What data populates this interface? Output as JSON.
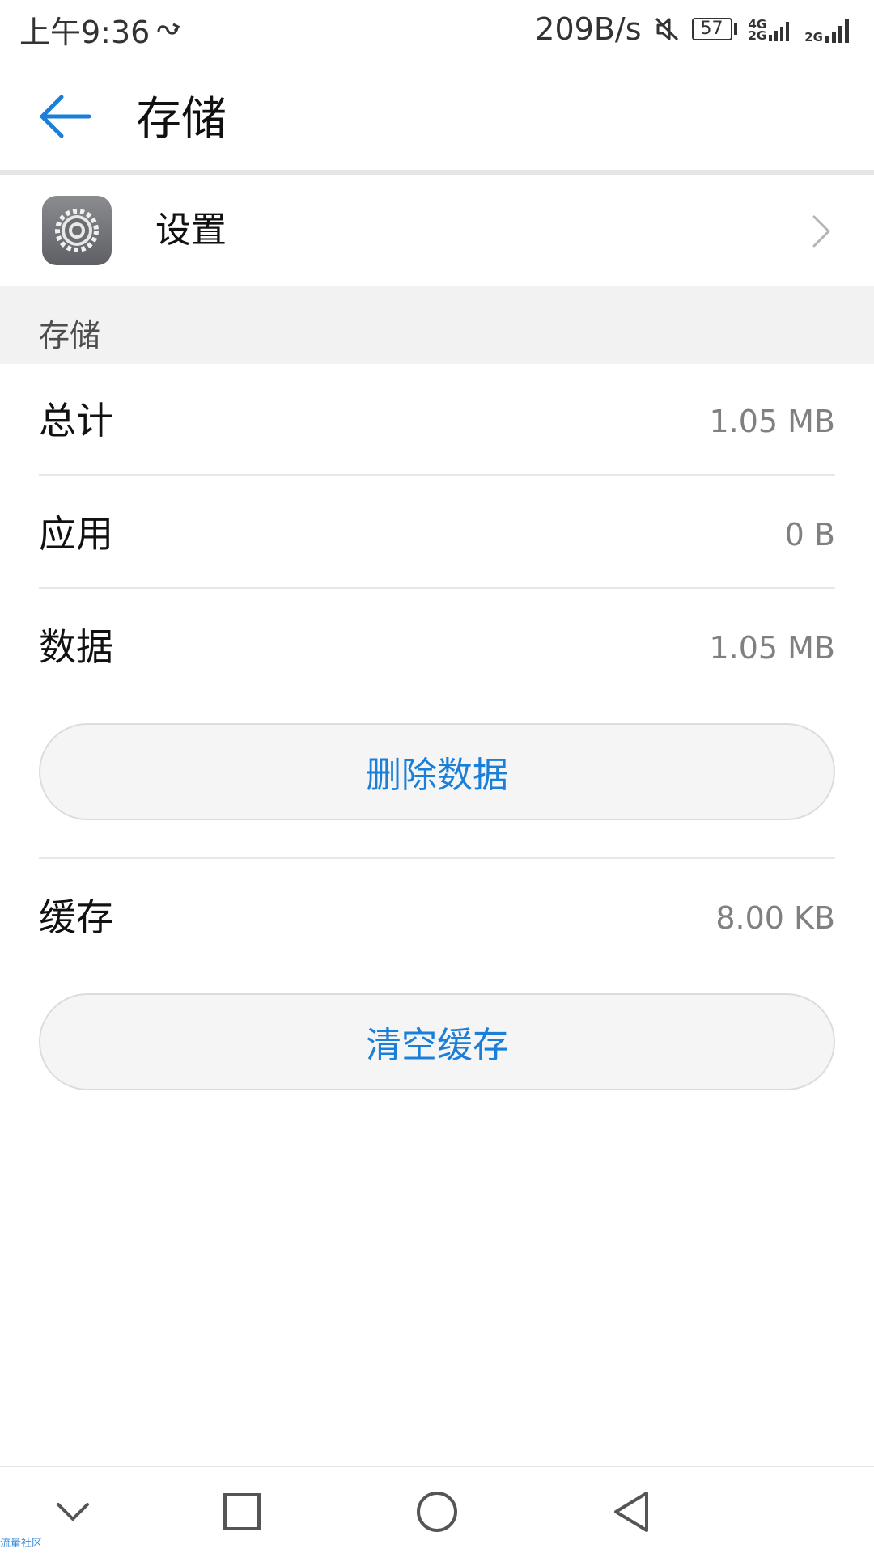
{
  "status_bar": {
    "time": "上午9:36",
    "network_speed": "209B/s",
    "battery_level": "57",
    "sim1_tags": [
      "4G",
      "2G"
    ],
    "sim2_tag": "2G",
    "icons": [
      "link-icon",
      "mute-icon",
      "battery-icon",
      "signal-icon"
    ]
  },
  "header": {
    "back_icon": "arrow-left-icon",
    "title": "存储"
  },
  "app": {
    "name": "设置",
    "icon": "gear-icon"
  },
  "storage_section": {
    "label": "存储",
    "total_label": "总计",
    "total_value": "1.05 MB",
    "apps_label": "应用",
    "apps_value": "0 B",
    "data_label": "数据",
    "data_value": "1.05 MB",
    "delete_data_button": "删除数据",
    "cache_label": "缓存",
    "cache_value": "8.00 KB",
    "clear_cache_button": "清空缓存"
  },
  "nav_bar": {
    "icons": [
      "chevron-down-icon",
      "square-recents-icon",
      "circle-home-icon",
      "triangle-back-icon"
    ]
  },
  "watermark": "流量社区",
  "colors": {
    "accent": "#1a7fd9",
    "section_bg": "#f2f2f2",
    "value_text": "#808080"
  }
}
